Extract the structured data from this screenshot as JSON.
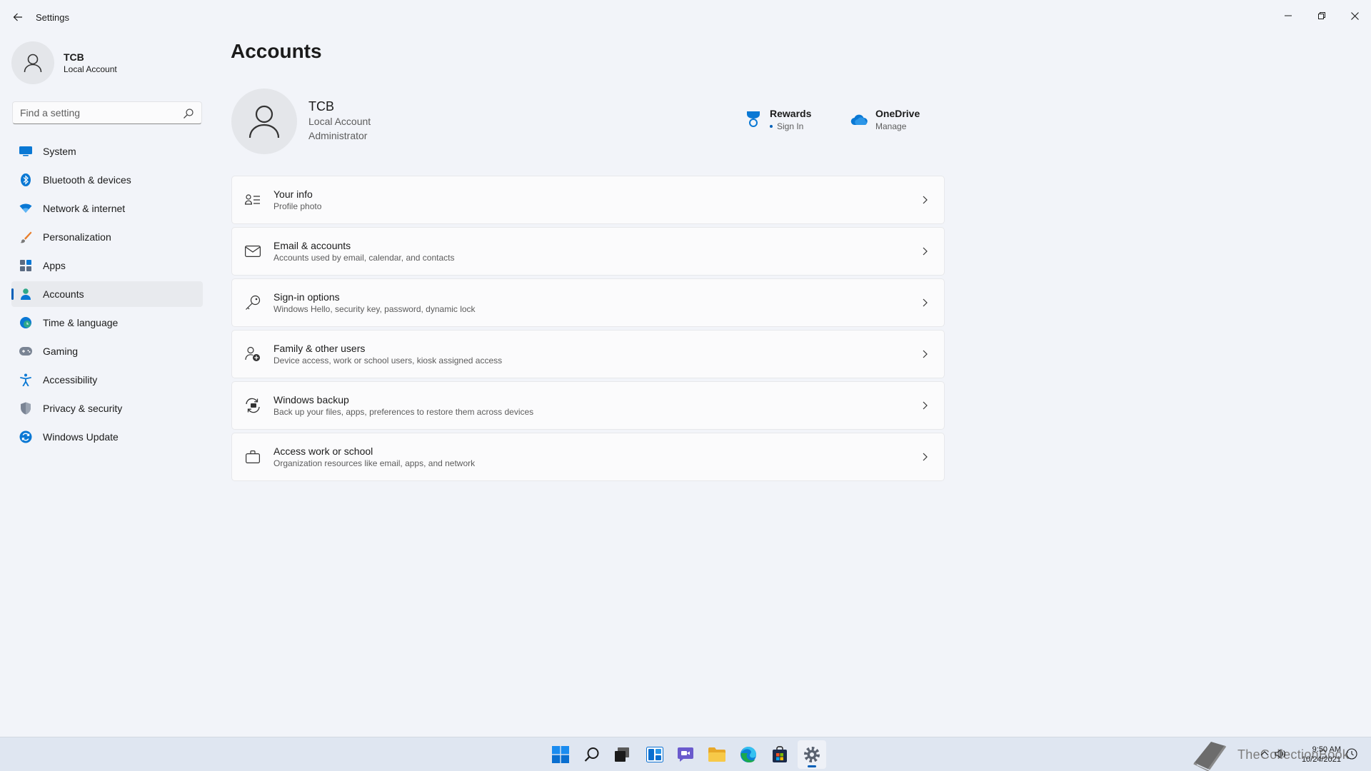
{
  "window": {
    "title": "Settings"
  },
  "sidebar": {
    "user_name": "TCB",
    "user_type": "Local Account",
    "search_placeholder": "Find a setting",
    "items": [
      {
        "label": "System",
        "icon": "monitor-icon",
        "active": false
      },
      {
        "label": "Bluetooth & devices",
        "icon": "bluetooth-icon",
        "active": false
      },
      {
        "label": "Network & internet",
        "icon": "wifi-icon",
        "active": false
      },
      {
        "label": "Personalization",
        "icon": "brush-icon",
        "active": false
      },
      {
        "label": "Apps",
        "icon": "apps-icon",
        "active": false
      },
      {
        "label": "Accounts",
        "icon": "person-icon",
        "active": true
      },
      {
        "label": "Time & language",
        "icon": "globe-clock-icon",
        "active": false
      },
      {
        "label": "Gaming",
        "icon": "gamepad-icon",
        "active": false
      },
      {
        "label": "Accessibility",
        "icon": "accessibility-icon",
        "active": false
      },
      {
        "label": "Privacy & security",
        "icon": "shield-icon",
        "active": false
      },
      {
        "label": "Windows Update",
        "icon": "update-icon",
        "active": false
      }
    ]
  },
  "main": {
    "page_title": "Accounts",
    "profile": {
      "name": "TCB",
      "line1": "Local Account",
      "line2": "Administrator"
    },
    "rewards": {
      "title": "Rewards",
      "sub": "Sign In"
    },
    "onedrive": {
      "title": "OneDrive",
      "sub": "Manage"
    },
    "cards": [
      {
        "title": "Your info",
        "sub": "Profile photo",
        "icon": "contact-card-icon"
      },
      {
        "title": "Email & accounts",
        "sub": "Accounts used by email, calendar, and contacts",
        "icon": "mail-icon"
      },
      {
        "title": "Sign-in options",
        "sub": "Windows Hello, security key, password, dynamic lock",
        "icon": "key-icon"
      },
      {
        "title": "Family & other users",
        "sub": "Device access, work or school users, kiosk assigned access",
        "icon": "family-icon"
      },
      {
        "title": "Windows backup",
        "sub": "Back up your files, apps, preferences to restore them across devices",
        "icon": "backup-icon"
      },
      {
        "title": "Access work or school",
        "sub": "Organization resources like email, apps, and network",
        "icon": "briefcase-icon"
      }
    ]
  },
  "taskbar": {
    "apps": [
      "start-icon",
      "search-icon",
      "task-view-icon",
      "widgets-icon",
      "chat-icon",
      "file-explorer-icon",
      "edge-icon",
      "store-icon",
      "settings-icon"
    ],
    "watermark": "TheCollectionBook",
    "time": "9:50 AM",
    "date": "10/24/2021"
  },
  "colors": {
    "accent": "#005fb8",
    "background": "#f2f4f9",
    "card": "#fbfbfc",
    "taskbar": "#dfe6f1"
  }
}
